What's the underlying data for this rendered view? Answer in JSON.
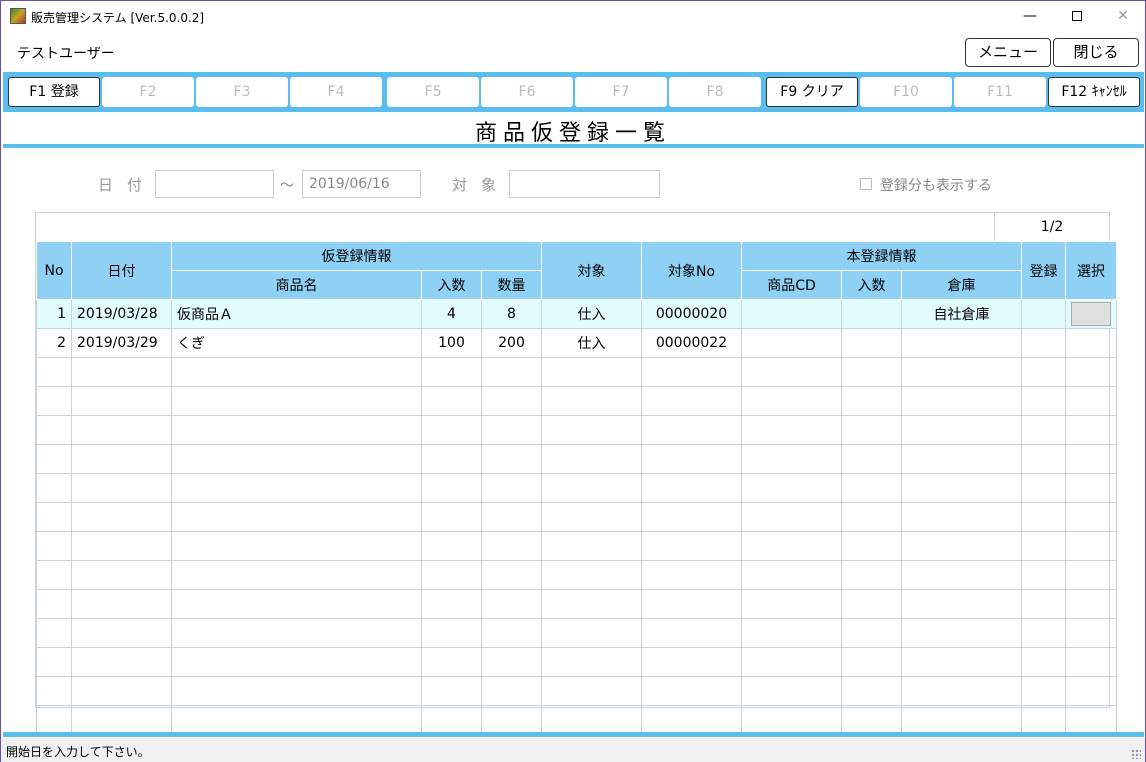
{
  "window": {
    "title": "販売管理システム [Ver.5.0.0.2]"
  },
  "header": {
    "user": "テストユーザー",
    "menu_label": "メニュー",
    "close_label": "閉じる"
  },
  "fkeys": [
    {
      "label": "F1 登録",
      "enabled": true
    },
    {
      "label": "F2",
      "enabled": false
    },
    {
      "label": "F3",
      "enabled": false
    },
    {
      "label": "F4",
      "enabled": false
    },
    {
      "label": "F5",
      "enabled": false
    },
    {
      "label": "F6",
      "enabled": false
    },
    {
      "label": "F7",
      "enabled": false
    },
    {
      "label": "F8",
      "enabled": false
    },
    {
      "label": "F9 クリア",
      "enabled": true
    },
    {
      "label": "F10",
      "enabled": false
    },
    {
      "label": "F11",
      "enabled": false
    },
    {
      "label": "F12 ｷｬﾝｾﾙ",
      "enabled": true
    }
  ],
  "page_title": "商品仮登録一覧",
  "filter": {
    "date_label": "日付",
    "date_from": "",
    "date_to": "2019/06/16",
    "tilde": "～",
    "target_label": "対象",
    "target_value": "",
    "show_registered_label": "登録分も表示する",
    "show_registered_checked": false
  },
  "grid": {
    "page_indicator": "1/2",
    "headers": {
      "no": "No",
      "date": "日付",
      "temp_group": "仮登録情報",
      "product_name": "商品名",
      "temp_qty_in": "入数",
      "temp_qty": "数量",
      "target": "対象",
      "target_no": "対象No",
      "main_group": "本登録情報",
      "product_cd": "商品CD",
      "main_qty_in": "入数",
      "warehouse": "倉庫",
      "registered": "登録",
      "select": "選択"
    },
    "rows": [
      {
        "no": "1",
        "date": "2019/03/28",
        "product_name": "仮商品Ａ",
        "qty_in": "4",
        "qty": "8",
        "target": "仕入",
        "target_no": "00000020",
        "product_cd": "",
        "main_qty_in": "",
        "warehouse": "自社倉庫",
        "registered": ""
      },
      {
        "no": "2",
        "date": "2019/03/29",
        "product_name": "くぎ",
        "qty_in": "100",
        "qty": "200",
        "target": "仕入",
        "target_no": "00000022",
        "product_cd": "",
        "main_qty_in": "",
        "warehouse": "",
        "registered": ""
      }
    ]
  },
  "status": {
    "message": "開始日を入力して下さい。"
  },
  "colors": {
    "accent": "#5bbcf0",
    "header_bg": "#8fd0f5",
    "selected_row": "#e2fbfc"
  }
}
